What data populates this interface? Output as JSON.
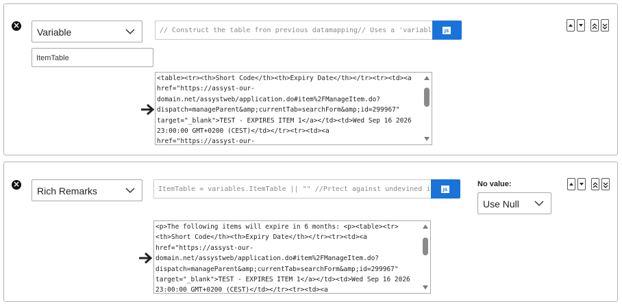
{
  "rows": [
    {
      "type_select": "Variable",
      "name_value": "ItemTable",
      "expression": "// Construct the table fron previous datamapping// Uses a 'variabl",
      "js_button_label": "JS",
      "preview": "<table><tr><th>Short Code</th><th>Expiry Date</th></tr><tr><td><a\nhref=\"https://assyst-our-\ndomain.net/assystweb/application.do#item%2FManageItem.do?\ndispatch=manageParent&amp;currentTab=searchForm&amp;id=299967\"\ntarget=\"_blank\">TEST - EXPIRES ITEM 1</a></td><td>Wed Sep 16 2026\n23:00:00 GMT+0200 (CEST)</td></tr><tr><td><a\nhref=\"https://assyst-our-"
    },
    {
      "type_select": "Rich Remarks",
      "expression": "ItemTable = variables.ItemTable || \"\" //Prtect against undevined i",
      "js_button_label": "JS",
      "no_value_label": "No value:",
      "no_value_select": "Use Null",
      "preview": "<p>The following items will expire in 6 months: <p><table><tr>\n<th>Short Code</th><th>Expiry Date</th></tr><tr><td><a\nhref=\"https://assyst-our-\ndomain.net/assystweb/application.do#item%2FManageItem.do?\ndispatch=manageParent&amp;currentTab=searchForm&amp;id=299967\"\ntarget=\"_blank\">TEST - EXPIRES ITEM 1</a></td><td>Wed Sep 16 2026\n23:00:00 GMT+0200 (CEST)</td></tr><tr><td><a"
    }
  ],
  "icons": {
    "remove": "close-circle-icon",
    "chevron": "chevron-down-icon",
    "arrow": "arrow-right-icon",
    "move_up": "caret-up-icon",
    "move_down": "caret-down-icon",
    "move_top": "double-caret-up-icon",
    "move_bottom": "double-caret-down-icon"
  },
  "colors": {
    "accent": "#1a73d9",
    "border": "#a8a8a8"
  }
}
